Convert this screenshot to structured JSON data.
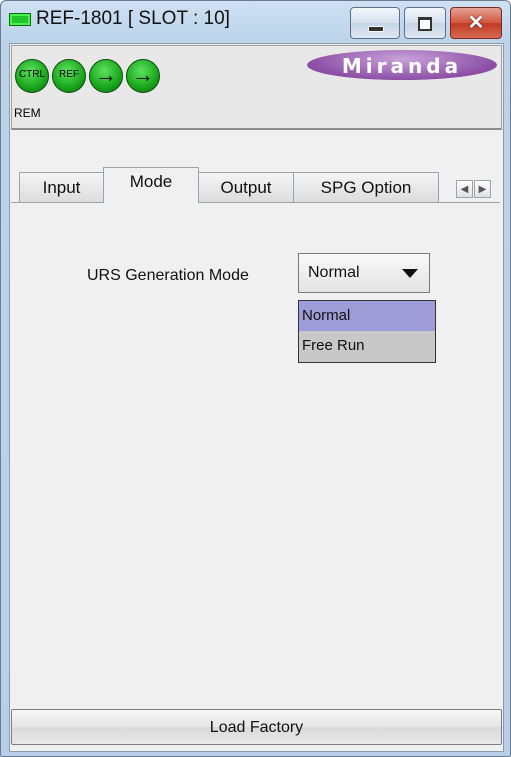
{
  "window": {
    "title": "REF-1801 [ SLOT : 10]",
    "controls": {
      "minimize_icon": "minimize-icon",
      "maximize_icon": "maximize-icon",
      "close_glyph": "✕"
    }
  },
  "header": {
    "status_icons": [
      {
        "label": "CTRL",
        "name": "ctrl-status-icon"
      },
      {
        "label": "REF",
        "name": "ref-status-icon"
      },
      {
        "glyph": "→",
        "name": "arrow-status-icon-1"
      },
      {
        "glyph": "→",
        "name": "arrow-status-icon-2"
      }
    ],
    "rem_label": "REM",
    "brand": "Miranda"
  },
  "tabs": [
    {
      "label": "Input",
      "active": false
    },
    {
      "label": "Mode",
      "active": true
    },
    {
      "label": "Output",
      "active": false
    },
    {
      "label": "SPG Option",
      "active": false
    }
  ],
  "tab_scroll": {
    "left": "◀",
    "right": "▶"
  },
  "mode_panel": {
    "urs_label": "URS Generation Mode",
    "urs_value": "Normal",
    "options": [
      "Normal",
      "Free Run"
    ],
    "selected_index": 0
  },
  "footer": {
    "load_factory_label": "Load Factory"
  },
  "colors": {
    "led_green": "#22c52a",
    "selected_option": "#9e9cd6",
    "close_button": "#c03a24",
    "brand_purple": "#8c4fa6"
  }
}
